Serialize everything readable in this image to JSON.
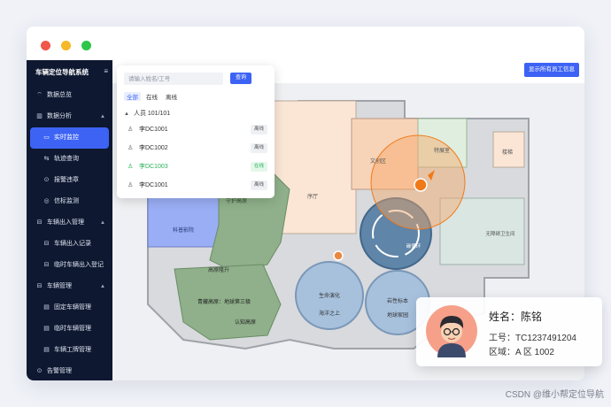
{
  "sidebar": {
    "title": "车辆定位导航系统",
    "menu_icon": "≡",
    "items": [
      {
        "label": "数据总览",
        "icon": "wifi-icon",
        "level": 0
      },
      {
        "label": "数据分析",
        "icon": "chart-icon",
        "level": 0,
        "expanded": true
      },
      {
        "label": "实时监控",
        "icon": "monitor-icon",
        "level": 1,
        "active": true
      },
      {
        "label": "轨迹查询",
        "icon": "route-icon",
        "level": 1
      },
      {
        "label": "报警违章",
        "icon": "alarm-icon",
        "level": 1
      },
      {
        "label": "信标监测",
        "icon": "beacon-icon",
        "level": 1
      },
      {
        "label": "车辆出入管理",
        "icon": "car-icon",
        "level": 0,
        "expanded": true
      },
      {
        "label": "车辆出入记录",
        "icon": "car-icon",
        "level": 1
      },
      {
        "label": "临时车辆出入登记",
        "icon": "car-icon",
        "level": 1
      },
      {
        "label": "车辆管理",
        "icon": "car-icon",
        "level": 0,
        "expanded": true
      },
      {
        "label": "固定车辆管理",
        "icon": "list-icon",
        "level": 1
      },
      {
        "label": "临时车辆管理",
        "icon": "list-icon",
        "level": 1
      },
      {
        "label": "车辆工牌管理",
        "icon": "list-icon",
        "level": 1
      },
      {
        "label": "告警管理",
        "icon": "alarm-icon",
        "level": 0
      }
    ]
  },
  "topbar": {
    "show_all_label": "显示所有员工信息"
  },
  "search": {
    "placeholder": "请输入姓名/工号",
    "query_label": "查询",
    "tabs": [
      "全部",
      "在线",
      "离线"
    ],
    "active_tab": 0,
    "group_label": "人员 101/101",
    "people": [
      {
        "name": "李DC1001",
        "status": "离线",
        "online": false
      },
      {
        "name": "李DC1002",
        "status": "离线",
        "online": false
      },
      {
        "name": "李DC1003",
        "status": "在线",
        "online": true
      },
      {
        "name": "李DC1001",
        "status": "离线",
        "online": false
      }
    ]
  },
  "map": {
    "labels": {
      "hall": "序厅",
      "culture": "文创区",
      "special": "特展室",
      "stairs": "楼梯",
      "wc": "无障碍卫生间",
      "tech": "科普影院",
      "guard": "守护高原",
      "plateau_change": "高原隆升",
      "life": "生命演化",
      "cycle": "碳循环",
      "rock": "岩性标本",
      "weather": "青藏高原：地球第三极",
      "sea": "海洋之上",
      "geo": "地球家园",
      "know": "认知高原"
    },
    "colors": {
      "online": "#2bb45a",
      "accent": "#3d63f5",
      "marker": "#f07a1a"
    }
  },
  "card": {
    "name_label": "姓名：",
    "name": "陈铭",
    "id_label": "工号：",
    "id": "TC1237491204",
    "area_label": "区域：",
    "area": "A 区 1002"
  },
  "watermark": "CSDN @维小帮定位导航"
}
